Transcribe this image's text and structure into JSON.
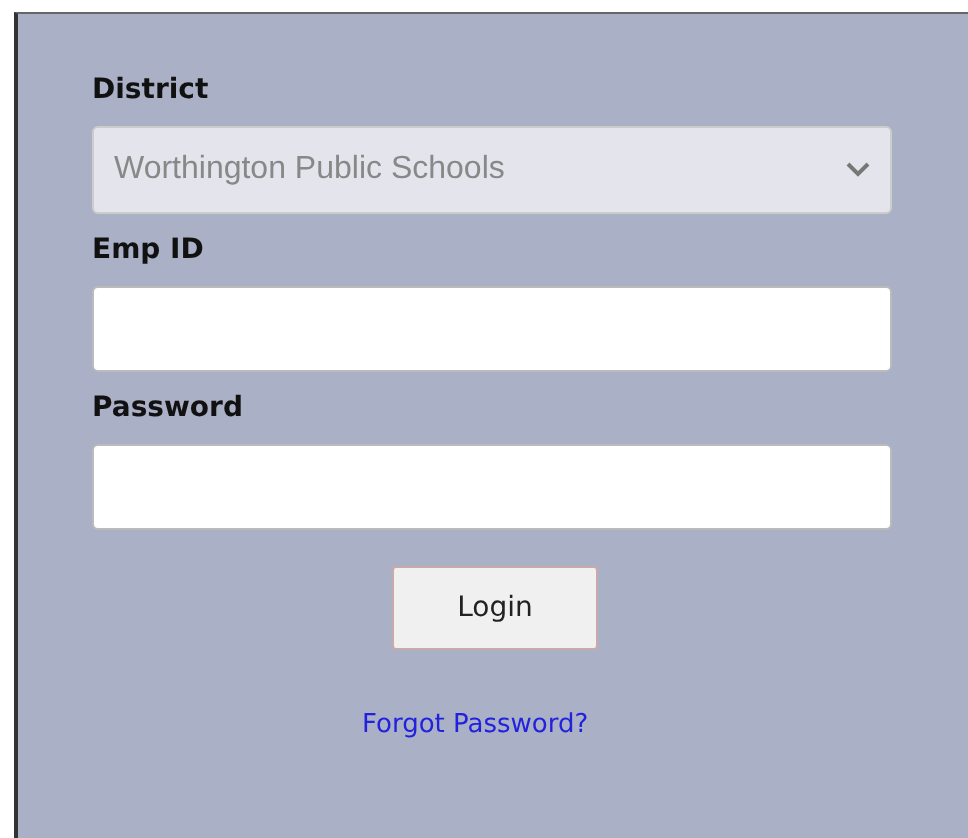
{
  "fields": [
    {
      "kind": "select",
      "label": "District",
      "value": "Worthington Public Schools",
      "disabled": true
    },
    {
      "kind": "text",
      "label": "Emp ID"
    },
    {
      "kind": "password",
      "label": "Password"
    }
  ],
  "login_button": "Login",
  "forgot_link": "Forgot Password?"
}
